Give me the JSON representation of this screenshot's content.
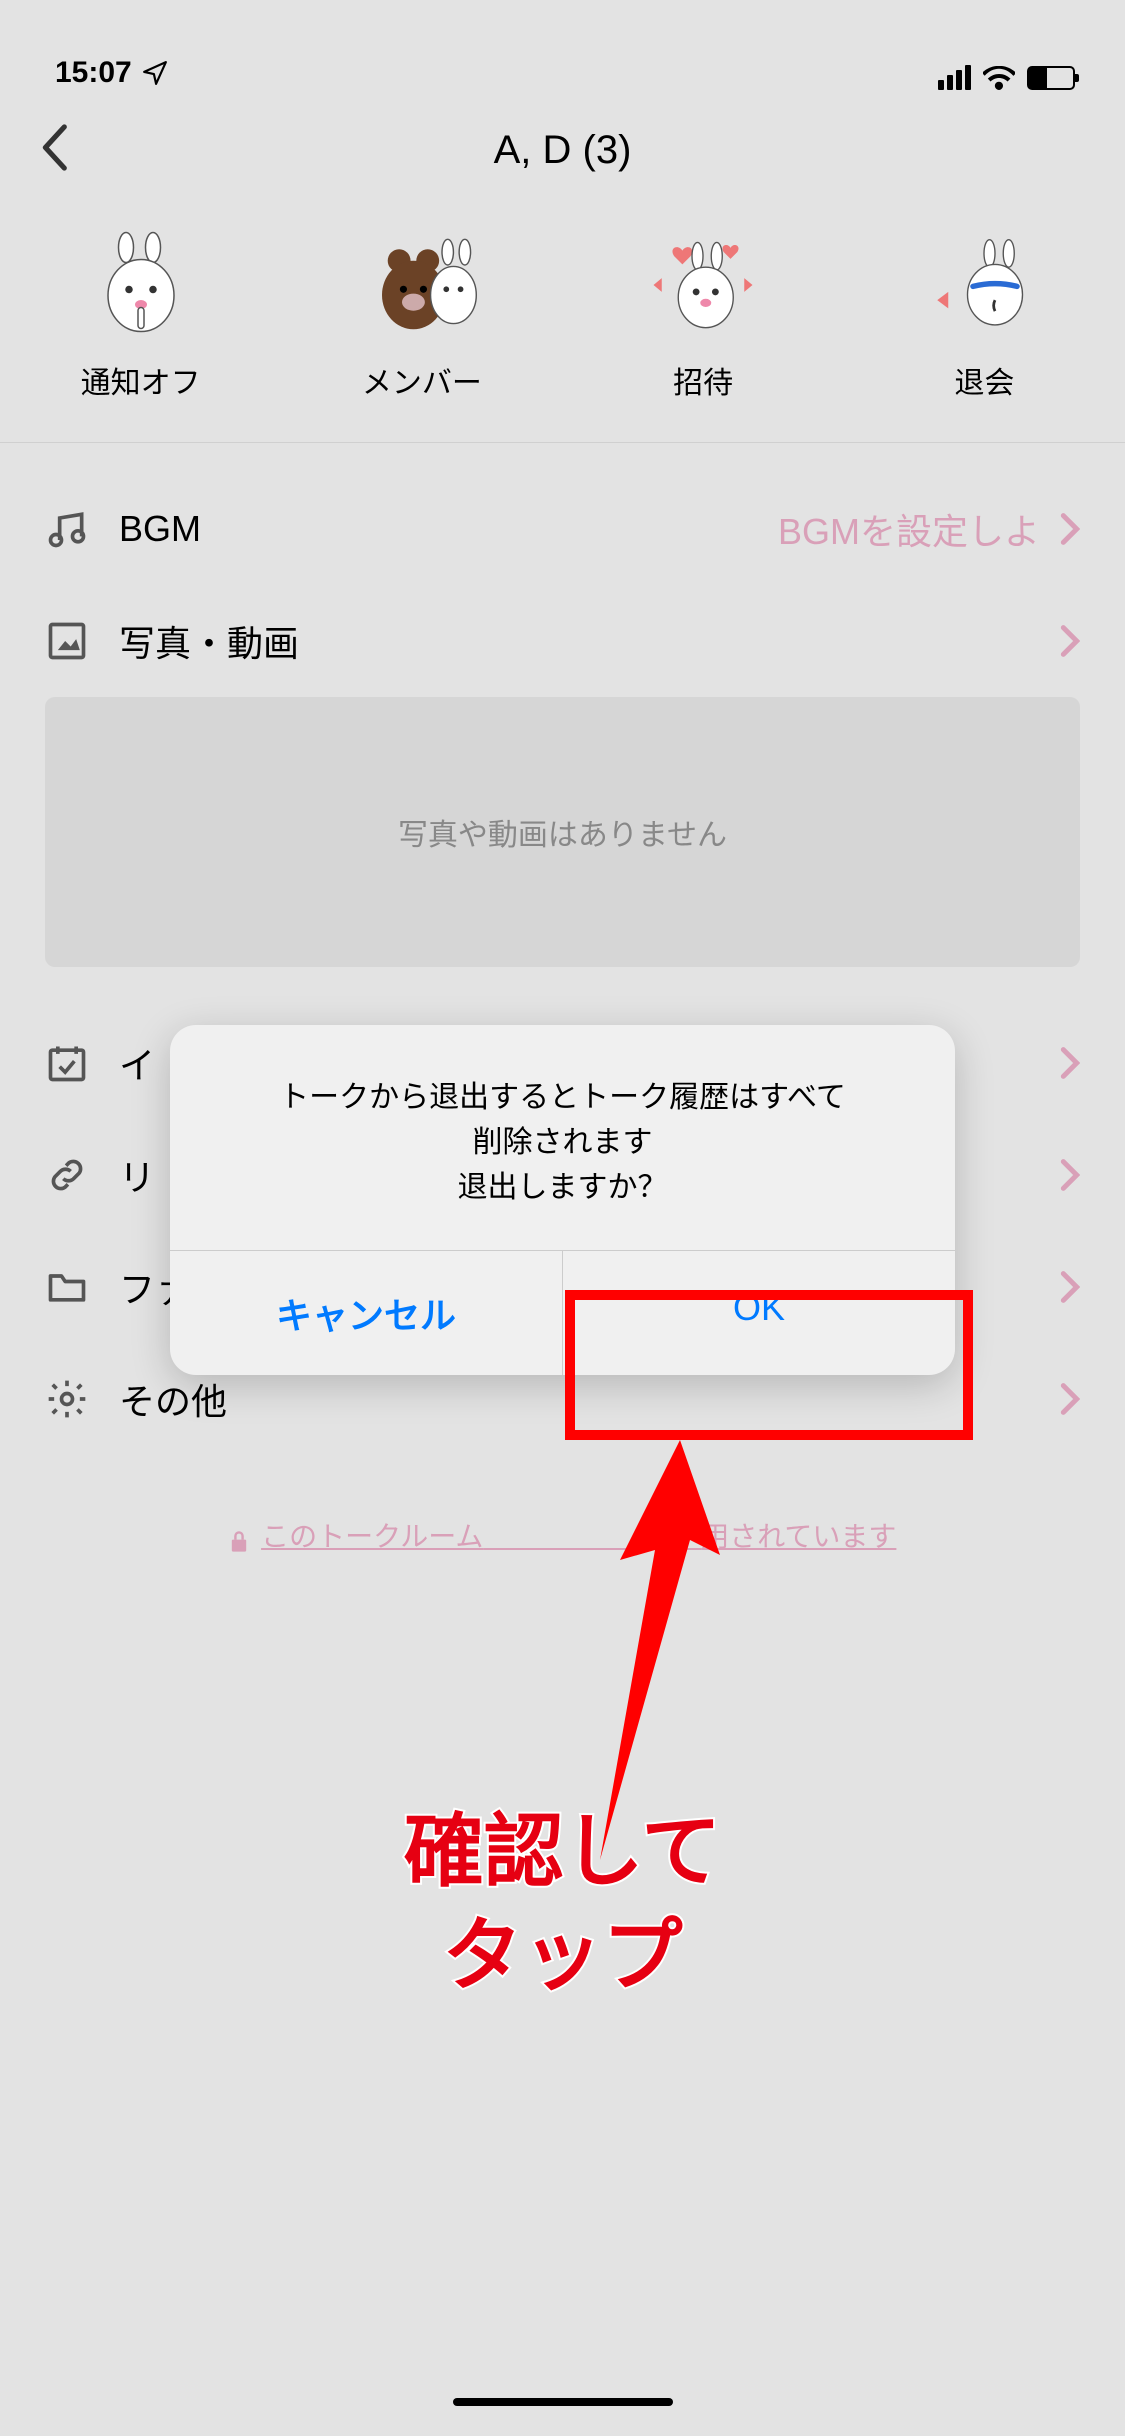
{
  "status": {
    "time": "15:07"
  },
  "header": {
    "title": "A, D (3)"
  },
  "shortcuts": [
    {
      "label": "通知オフ"
    },
    {
      "label": "メンバー"
    },
    {
      "label": "招待"
    },
    {
      "label": "退会"
    }
  ],
  "rows": {
    "bgm": {
      "label": "BGM",
      "value": "BGMを設定しよ"
    },
    "media": {
      "label": "写真・動画",
      "empty": "写真や動画はありません"
    },
    "event": {
      "label": "イ"
    },
    "link": {
      "label": "リ"
    },
    "file": {
      "label": "ファイル"
    },
    "other": {
      "label": "その他"
    }
  },
  "footer": {
    "link_left": "このトークルーム",
    "link_right": "用されています"
  },
  "modal": {
    "line1": "トークから退出するとトーク履歴はすべて",
    "line2": "削除されます",
    "line3": "退出しますか？",
    "cancel": "キャンセル",
    "ok": "OK"
  },
  "annotation": {
    "line1": "確認して",
    "line2": "タップ"
  }
}
